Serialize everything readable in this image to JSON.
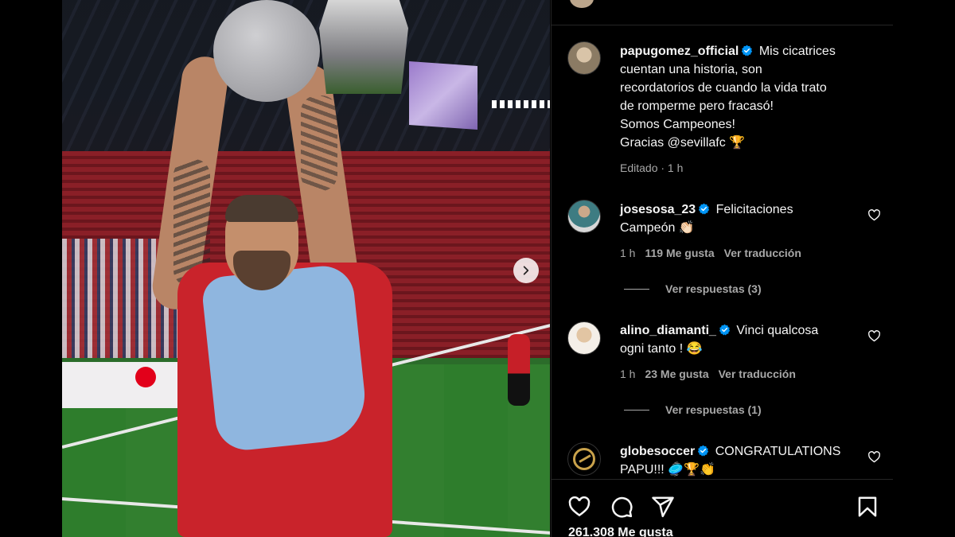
{
  "post": {
    "author": "papugomez_official",
    "caption_lines": [
      "Mis cicatrices",
      "cuentan una historia, son",
      "recordatorios de cuando la vida trato",
      "de romperme pero fracasó!",
      "Somos Campeones!",
      "Gracias @sevillafc 🏆"
    ],
    "edited_label": "Editado · 1 h"
  },
  "comments": [
    {
      "username": "josesosa_23",
      "text_line1": "Felicitaciones",
      "text_line2": "Campeón 👏🏻",
      "time": "1 h",
      "likes": "119 Me gusta",
      "translate": "Ver traducción",
      "replies": "Ver respuestas (3)"
    },
    {
      "username": "alino_diamanti_",
      "text_line1": "Vinci qualcosa",
      "text_line2": "ogni tanto ! 😂",
      "time": "1 h",
      "likes": "23 Me gusta",
      "translate": "Ver traducción",
      "replies": "Ver respuestas (1)"
    },
    {
      "username": "globesoccer",
      "text_line1": "CONGRATULATIONS",
      "text_line2": "PAPU!!! 🥏🏆👏"
    }
  ],
  "footer": {
    "likes_total": "261.308 Me gusta"
  },
  "icons": {
    "verified": "verified-badge-icon",
    "like": "heart-icon",
    "comment": "comment-icon",
    "share": "share-icon",
    "save": "bookmark-icon",
    "next": "chevron-right-icon"
  },
  "colors": {
    "verified": "#0095f6",
    "background": "#000000",
    "secondary_text": "#a8a8a8"
  }
}
